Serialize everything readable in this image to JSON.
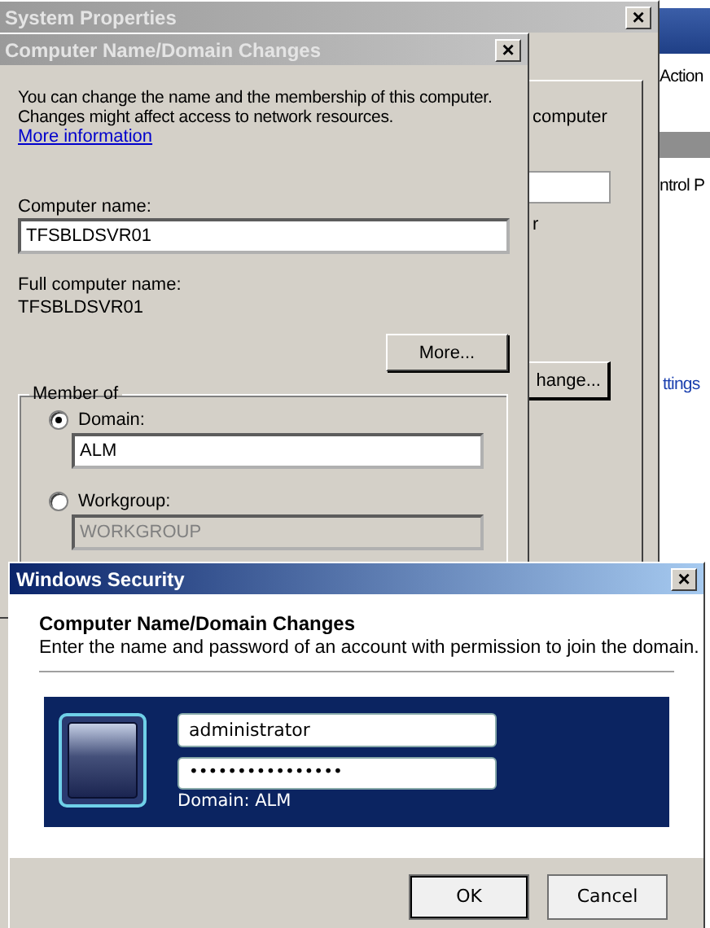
{
  "background_window": {
    "texts": [
      "Action",
      "ntrol P",
      "ttings"
    ]
  },
  "system_properties": {
    "title": "System Properties",
    "close": "×",
    "peek_texts": [
      "computer",
      "r"
    ],
    "peek_button": "hange..."
  },
  "name_dialog": {
    "title": "Computer Name/Domain Changes",
    "close": "×",
    "description": "You can change the name and the membership of this computer. Changes might affect access to network resources.",
    "link": "More information",
    "computer_name_label": "Computer name:",
    "computer_name": "TFSBLDSVR01",
    "full_name_label": "Full computer name:",
    "full_name": "TFSBLDSVR01",
    "more_button": "More...",
    "member_of": "Member of",
    "options": [
      {
        "label": "Domain:",
        "selected": true,
        "value": "ALM",
        "disabled": false
      },
      {
        "label": "Workgroup:",
        "selected": false,
        "value": "WORKGROUP",
        "disabled": true
      }
    ]
  },
  "security_dialog": {
    "title": "Windows Security",
    "close": "×",
    "heading": "Computer Name/Domain Changes",
    "description": "Enter the name and password of an account with permission to join the domain.",
    "username": "administrator",
    "password": "••••••••••••••••",
    "domain": "Domain: ALM",
    "buttons": [
      "OK",
      "Cancel"
    ]
  }
}
